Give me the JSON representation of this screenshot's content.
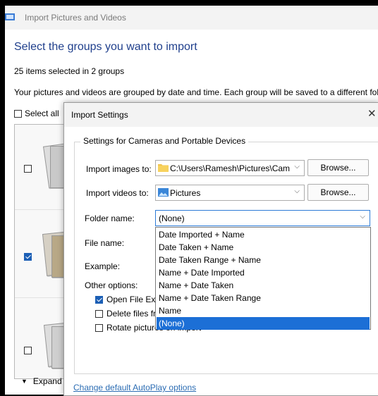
{
  "main_window": {
    "title": "Import Pictures and Videos",
    "heading": "Select the groups you want to import",
    "items_selected": "25 items selected in 2 groups",
    "description": "Your pictures and videos are grouped by date and time. Each group will be saved to a different fold",
    "select_all_label": "Select all",
    "select_all_checked": false,
    "groups": [
      {
        "checked": false
      },
      {
        "checked": true
      },
      {
        "checked": false
      }
    ],
    "expand_label": "Expand a"
  },
  "dialog": {
    "title": "Import Settings",
    "close_icon": "close-icon",
    "group_title": "Settings for Cameras and Portable Devices",
    "import_images_label": "Import images to:",
    "import_images_value": "C:\\Users\\Ramesh\\Pictures\\Cam",
    "import_videos_label": "Import videos to:",
    "import_videos_value": "Pictures",
    "browse_label": "Browse...",
    "folder_name_label": "Folder name:",
    "folder_name_value": "(None)",
    "file_name_label": "File name:",
    "example_label": "Example:",
    "other_options_label": "Other options:",
    "options": [
      {
        "label": "Open File Exp",
        "checked": true
      },
      {
        "label": "Delete files fro",
        "checked": false
      },
      {
        "label": "Rotate pictures on import",
        "checked": false
      }
    ],
    "folder_options": [
      "Date Imported + Name",
      "Date Taken + Name",
      "Date Taken Range + Name",
      "Name + Date Imported",
      "Name + Date Taken",
      "Name + Date Taken Range",
      "Name",
      "(None)"
    ],
    "selected_option": "(None)",
    "autoplay_link": "Change default AutoPlay options"
  },
  "colors": {
    "accent": "#1c6fd6",
    "heading": "#1f3f8c",
    "link": "#2b6cb3"
  }
}
